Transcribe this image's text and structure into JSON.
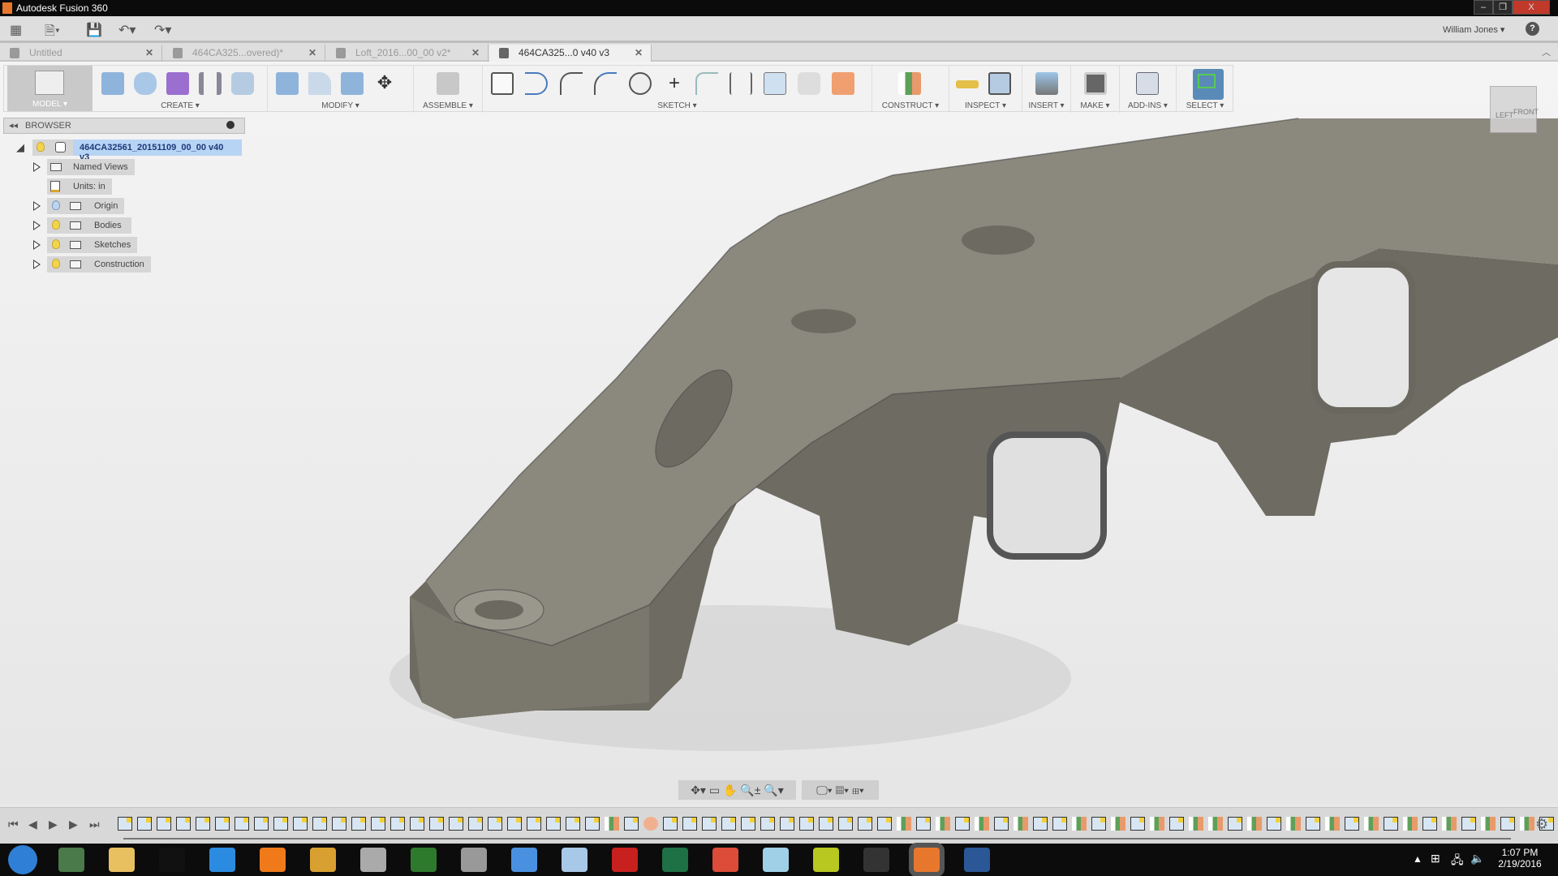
{
  "window": {
    "title": "Autodesk Fusion 360",
    "controls": [
      "–",
      "❐",
      "X"
    ]
  },
  "apptoolbar": {
    "user": "William Jones ▾",
    "help": "?"
  },
  "tabs": [
    {
      "label": "Untitled",
      "active": false
    },
    {
      "label": "464CA325...overed)*",
      "active": false
    },
    {
      "label": "Loft_2016...00_00 v2*",
      "active": false
    },
    {
      "label": "464CA325...0 v40 v3",
      "active": true
    }
  ],
  "ribbon": {
    "workspace": "MODEL ▾",
    "groups": [
      {
        "label": "CREATE ▾"
      },
      {
        "label": "MODIFY ▾"
      },
      {
        "label": "ASSEMBLE ▾"
      },
      {
        "label": "SKETCH ▾"
      },
      {
        "label": "CONSTRUCT ▾"
      },
      {
        "label": "INSPECT ▾"
      },
      {
        "label": "INSERT ▾"
      },
      {
        "label": "MAKE ▾"
      },
      {
        "label": "ADD-INS ▾"
      },
      {
        "label": "SELECT ▾"
      }
    ]
  },
  "browser": {
    "title": "BROWSER",
    "root": "464CA32561_20151109_00_00 v40 v3",
    "items": [
      {
        "label": "Named Views"
      },
      {
        "label": "Units: in"
      },
      {
        "label": "Origin"
      },
      {
        "label": "Bodies"
      },
      {
        "label": "Sketches"
      },
      {
        "label": "Construction"
      }
    ]
  },
  "viewcube": {
    "left": "LEFT",
    "front": "FRONT"
  },
  "timeline": {
    "items": "ssssssssssssssssssssssssspsfsssssssssssspspspspsspspspsppspspspspspspspsps"
  },
  "taskbar": {
    "time": "1:07 PM",
    "date": "2/19/2016",
    "apps": [
      "start",
      "task-manager",
      "file-explorer",
      "command-prompt",
      "internet-explorer",
      "media-player",
      "solitaire",
      "chess",
      "green-app",
      "airplane-app",
      "airplane-blue-app",
      "calculator",
      "acrobat",
      "excel",
      "chrome",
      "paper-app",
      "lightning-app",
      "camera-app",
      "fusion-360",
      "word"
    ],
    "active": "fusion-360"
  }
}
